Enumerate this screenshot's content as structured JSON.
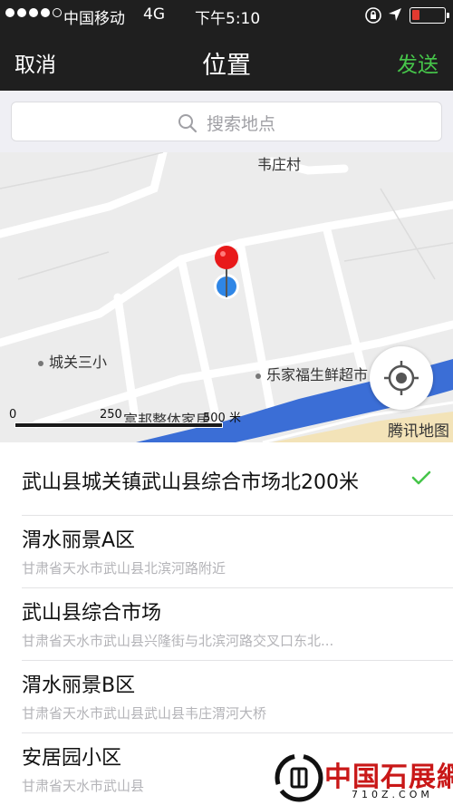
{
  "status_bar": {
    "carrier": "中国移动",
    "network": "4G",
    "time": "下午5:10",
    "signal_bars_filled": 4,
    "signal_bars_total": 5,
    "battery_level": 0.2,
    "icons": [
      "orientation-lock-icon",
      "location-arrow-icon",
      "battery-icon"
    ]
  },
  "nav": {
    "cancel_label": "取消",
    "title": "位置",
    "send_label": "发送",
    "send_color": "#46c54a"
  },
  "search": {
    "placeholder": "搜索地点",
    "icon": "search-icon"
  },
  "map": {
    "labels": {
      "village": "韦庄村",
      "school": "城关三小",
      "supermarket": "乐家福生鲜超市",
      "furniture": "富邦整体家居"
    },
    "scale": {
      "start": "0",
      "mid": "250",
      "end": "500 米"
    },
    "brand": "腾讯地图",
    "marker_color": "#e8191a",
    "location_dot_color": "#2f86e6",
    "river_color": "#3b6ed6"
  },
  "results": [
    {
      "title": "武山县城关镇武山县综合市场北200米",
      "subtitle": "",
      "selected": true
    },
    {
      "title": "渭水丽景A区",
      "subtitle": "甘肃省天水市武山县北滨河路附近",
      "selected": false
    },
    {
      "title": "武山县综合市场",
      "subtitle": "甘肃省天水市武山县兴隆街与北滨河路交叉口东北...",
      "selected": false
    },
    {
      "title": "渭水丽景B区",
      "subtitle": "甘肃省天水市武山县武山县韦庄渭河大桥",
      "selected": false
    },
    {
      "title": "安居园小区",
      "subtitle": "甘肃省天水市武山县",
      "selected": false
    }
  ],
  "watermark": {
    "name": "中国石展網",
    "site": "710Z.COM"
  }
}
